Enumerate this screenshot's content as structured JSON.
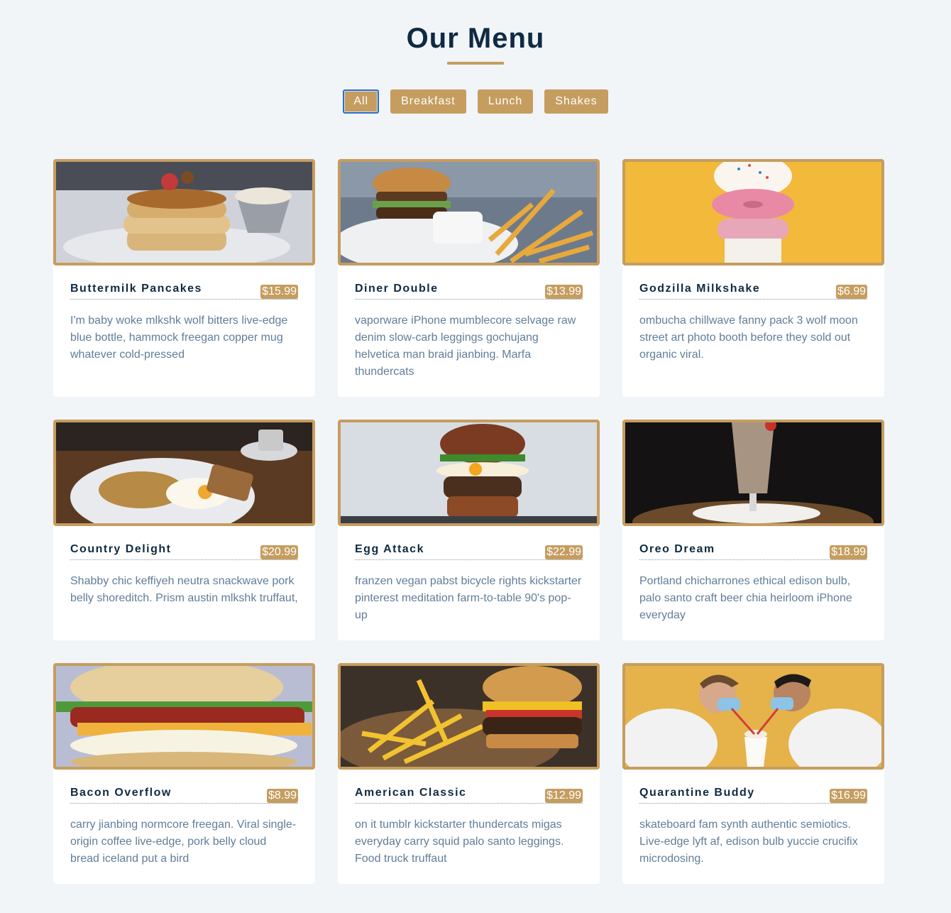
{
  "header": {
    "title": "Our Menu"
  },
  "filters": [
    {
      "label": "All",
      "active": true
    },
    {
      "label": "Breakfast",
      "active": false
    },
    {
      "label": "Lunch",
      "active": false
    },
    {
      "label": "Shakes",
      "active": false
    }
  ],
  "colors": {
    "accent": "#c59d5f",
    "title": "#102a42",
    "text": "#617d98",
    "background": "#f1f5f8"
  },
  "items": [
    {
      "name": "Buttermilk Pancakes",
      "price": "$15.99",
      "desc": "I'm baby woke mlkshk wolf bitters live-edge blue bottle, hammock freegan copper mug whatever cold-pressed",
      "image": "pancakes-photo"
    },
    {
      "name": "Diner Double",
      "price": "$13.99",
      "desc": "vaporware iPhone mumblecore selvage raw denim slow-carb leggings gochujang helvetica man braid jianbing. Marfa thundercats",
      "image": "burger-fries-photo"
    },
    {
      "name": "Godzilla Milkshake",
      "price": "$6.99",
      "desc": "ombucha chillwave fanny pack 3 wolf moon street art photo booth before they sold out organic viral.",
      "image": "donut-milkshake-photo"
    },
    {
      "name": "Country Delight",
      "price": "$20.99",
      "desc": "Shabby chic keffiyeh neutra snackwave pork belly shoreditch. Prism austin mlkshk truffaut,",
      "image": "eggs-toast-photo"
    },
    {
      "name": "Egg Attack",
      "price": "$22.99",
      "desc": "franzen vegan pabst bicycle rights kickstarter pinterest meditation farm-to-table 90's pop-up",
      "image": "egg-burger-photo"
    },
    {
      "name": "Oreo Dream",
      "price": "$18.99",
      "desc": "Portland chicharrones ethical edison bulb, palo santo craft beer chia heirloom iPhone everyday",
      "image": "oreo-shake-photo"
    },
    {
      "name": "Bacon Overflow",
      "price": "$8.99",
      "desc": "carry jianbing normcore freegan. Viral single-origin coffee live-edge, pork belly cloud bread iceland put a bird",
      "image": "bacon-biscuit-photo"
    },
    {
      "name": "American Classic",
      "price": "$12.99",
      "desc": "on it tumblr kickstarter thundercats migas everyday carry squid palo santo leggings. Food truck truffaut",
      "image": "classic-burger-photo"
    },
    {
      "name": "Quarantine Buddy",
      "price": "$16.99",
      "desc": "skateboard fam synth authentic semiotics. Live-edge lyft af, edison bulb yuccie crucifix microdosing.",
      "image": "couple-shake-photo"
    }
  ]
}
